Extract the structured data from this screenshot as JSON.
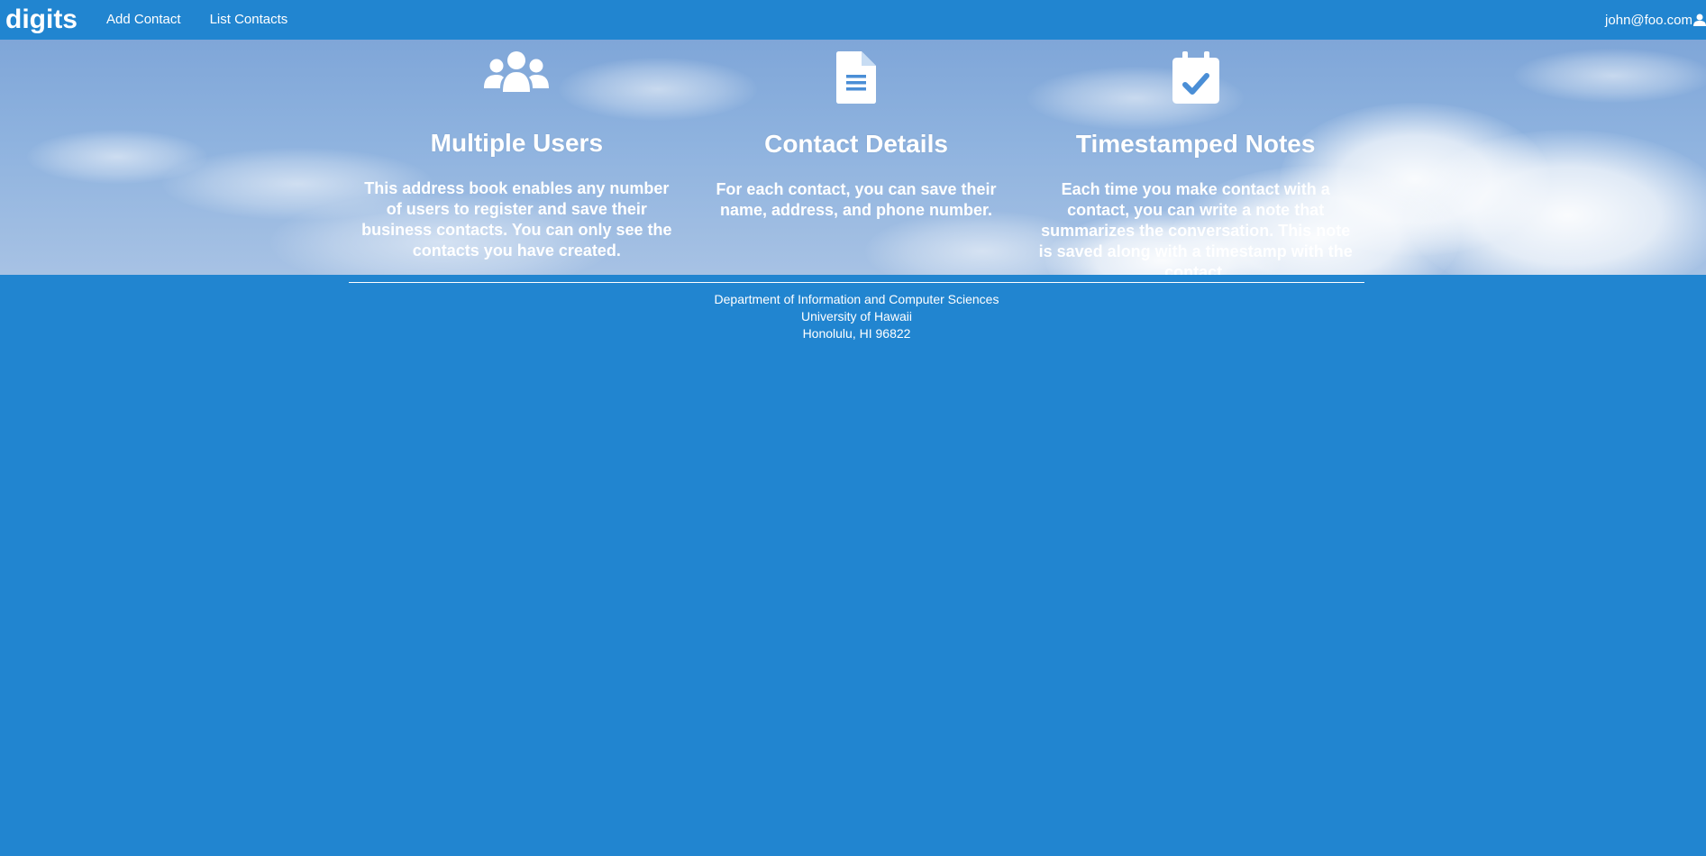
{
  "navbar": {
    "brand": "digits",
    "links": [
      "Add Contact",
      "List Contacts"
    ],
    "user_email": "john@foo.com",
    "user_icon": "user-icon"
  },
  "features": [
    {
      "icon": "users-icon",
      "title": "Multiple Users",
      "text": "This address book enables any number of users to register and save their business contacts. You can only see the contacts you have created."
    },
    {
      "icon": "file-text-icon",
      "title": "Contact Details",
      "text": "For each contact, you can save their name, address, and phone number."
    },
    {
      "icon": "calendar-check-icon",
      "title": "Timestamped Notes",
      "text": "Each time you make contact with a contact, you can write a note that summarizes the conversation. This note is saved along with a timestamp with the contact."
    }
  ],
  "footer": {
    "lines": [
      "Department of Information and Computer Sciences",
      "University of Hawaii",
      "Honolulu, HI 96822"
    ]
  },
  "colors": {
    "primary": "#2185d0",
    "text": "#ffffff"
  }
}
